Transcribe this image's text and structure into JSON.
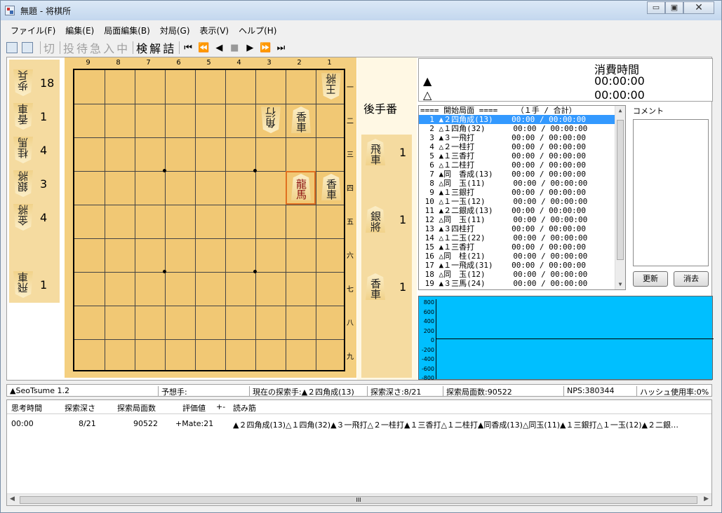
{
  "window": {
    "title": "無題 - 将棋所",
    "controls": [
      "▭",
      "▣",
      "✕"
    ]
  },
  "menu": [
    "ファイル(F)",
    "編集(E)",
    "局面編集(B)",
    "対局(G)",
    "表示(V)",
    "ヘルプ(H)"
  ],
  "toolbar": {
    "cmds": [
      "切",
      "投",
      "待",
      "急",
      "入",
      "中",
      "検",
      "解",
      "詰"
    ],
    "nav": [
      "⏮",
      "⏪",
      "◀",
      "■",
      "▶",
      "⏩",
      "⏭"
    ]
  },
  "board": {
    "files": [
      "9",
      "8",
      "7",
      "6",
      "5",
      "4",
      "3",
      "2",
      "1"
    ],
    "ranks": [
      "一",
      "二",
      "三",
      "四",
      "五",
      "六",
      "七",
      "八",
      "九"
    ],
    "pieces": [
      {
        "file": 1,
        "rank": 1,
        "label": "王將",
        "owner": "gote"
      },
      {
        "file": 3,
        "rank": 2,
        "label": "角行",
        "owner": "gote"
      },
      {
        "file": 2,
        "rank": 2,
        "label": "香車",
        "owner": "sente"
      },
      {
        "file": 2,
        "rank": 4,
        "label": "龍馬",
        "owner": "sente",
        "highlight": true
      },
      {
        "file": 1,
        "rank": 4,
        "label": "香車",
        "owner": "sente"
      }
    ]
  },
  "gote_label": "後手番",
  "left_hand": [
    {
      "label": "歩兵",
      "count": "18"
    },
    {
      "label": "香車",
      "count": "1"
    },
    {
      "label": "桂馬",
      "count": "4"
    },
    {
      "label": "銀將",
      "count": "3"
    },
    {
      "label": "金將",
      "count": "4"
    },
    {
      "label": "飛車",
      "count": "1"
    }
  ],
  "right_hand": [
    {
      "label": "飛車",
      "count": "1"
    },
    {
      "label": "銀將",
      "count": "1"
    },
    {
      "label": "香車",
      "count": "1"
    }
  ],
  "time": {
    "title": "消費時間",
    "sente_mark": "▲",
    "gote_mark": "△",
    "sente": "00:00:00",
    "gote": "00:00:00"
  },
  "kifu": {
    "header": "==== 開始局面 ====    （１手 / 合計）",
    "rows": [
      "  1 ▲２四角成(13)    00:00 / 00:00:00",
      "  2 △１四角(32)      00:00 / 00:00:00",
      "  3 ▲３一飛打        00:00 / 00:00:00",
      "  4 △２一桂打        00:00 / 00:00:00",
      "  5 ▲１三香打        00:00 / 00:00:00",
      "  6 △１二桂打        00:00 / 00:00:00",
      "  7 ▲同　香成(13)    00:00 / 00:00:00",
      "  8 △同　玉(11)      00:00 / 00:00:00",
      "  9 ▲１三銀打        00:00 / 00:00:00",
      " 10 △１一玉(12)      00:00 / 00:00:00",
      " 11 ▲２二銀成(13)    00:00 / 00:00:00",
      " 12 △同　玉(11)      00:00 / 00:00:00",
      " 13 ▲３四桂打        00:00 / 00:00:00",
      " 14 △１二玉(22)      00:00 / 00:00:00",
      " 15 ▲１三香打        00:00 / 00:00:00",
      " 16 △同　桂(21)      00:00 / 00:00:00",
      " 17 ▲１一飛成(31)    00:00 / 00:00:00",
      " 18 △同　玉(12)      00:00 / 00:00:00",
      " 19 ▲３三馬(24)      00:00 / 00:00:00"
    ]
  },
  "comment": {
    "label": "コメント",
    "update": "更新",
    "clear": "消去"
  },
  "graph": {
    "ticks": [
      "800",
      "600",
      "400",
      "200",
      "0",
      "-200",
      "-400",
      "-600",
      "-800"
    ]
  },
  "status": [
    "▲SeoTsume 1.2",
    "予想手:",
    "現在の探索手:▲２四角成(13)",
    "探索深さ:8/21",
    "探索局面数:90522",
    "NPS:380344",
    "ハッシュ使用率:0%"
  ],
  "analysis": {
    "headers": [
      "思考時間",
      "探索深さ",
      "探索局面数",
      "評価値",
      "+-",
      "読み筋"
    ],
    "row": [
      "00:00",
      "8/21",
      "90522",
      "+Mate:21",
      "",
      "▲２四角成(13)△１四角(32)▲３一飛打△２一桂打▲１三香打△１二桂打▲同香成(13)△同玉(11)▲１三銀打△１一玉(12)▲２二銀…"
    ]
  }
}
